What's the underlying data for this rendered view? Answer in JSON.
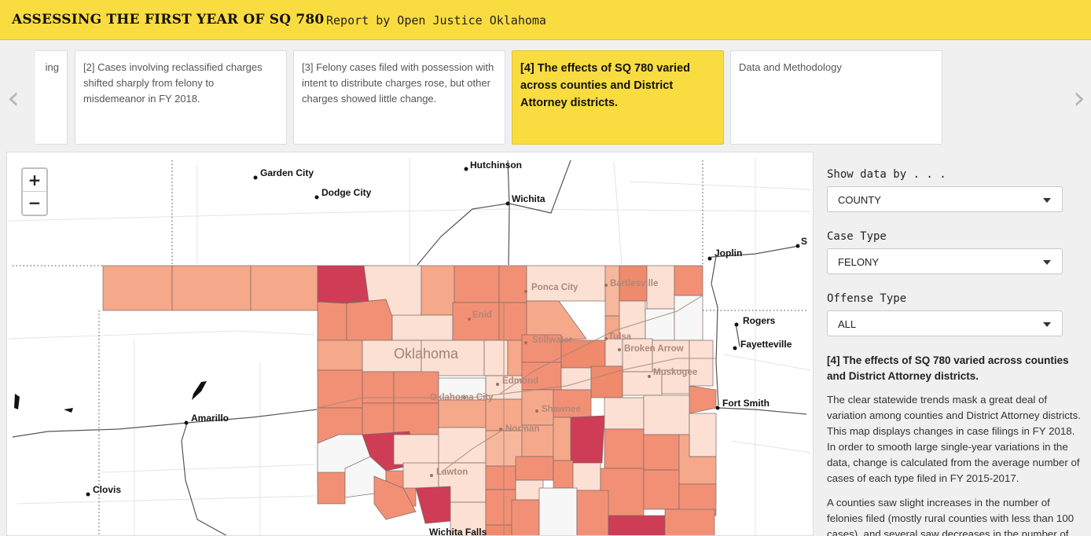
{
  "header": {
    "title": "ASSESSING THE FIRST YEAR OF SQ 780",
    "byline": "Report by Open Justice Oklahoma"
  },
  "nav": {
    "prev_icon": "chevron-left-icon",
    "next_icon": "chevron-right-icon"
  },
  "cards": [
    {
      "text": "ing",
      "active": false
    },
    {
      "text": "[2] Cases involving reclassified charges shifted sharply from felony to misdemeanor in FY 2018.",
      "active": false
    },
    {
      "text": "[3] Felony cases filed with possession with intent to distribute charges rose, but other charges showed little change.",
      "active": false
    },
    {
      "text": "[4] The effects of SQ 780 varied across counties and District Attorney districts.",
      "active": true
    },
    {
      "text": "Data and Methodology",
      "active": false
    }
  ],
  "map": {
    "zoom_in": "+",
    "zoom_out": "−",
    "state_label": "Oklahoma",
    "cities": [
      "Garden City",
      "Dodge City",
      "Hutchinson",
      "Wichita",
      "Joplin",
      "S",
      "Rogers",
      "Fayetteville",
      "Fort Smith",
      "Amarillo",
      "Clovis",
      "Wichita Falls"
    ],
    "faint_cities": [
      "Ponca City",
      "Bartlesville",
      "Enid",
      "Stillwater",
      "Tulsa",
      "Broken Arrow",
      "Muskogee",
      "Edmond",
      "Oklahoma City",
      "Shawnee",
      "Norman",
      "Lawton"
    ],
    "colors": {
      "dark": "#cf3c55",
      "mid": "#ef9478",
      "light": "#f6b79c",
      "pale": "#fbe0d3",
      "white": "#f7f7f7"
    }
  },
  "controls": {
    "show_label": "Show data by . . .",
    "show_value": "COUNTY",
    "case_label": "Case Type",
    "case_value": "FELONY",
    "offense_label": "Offense Type",
    "offense_value": "ALL"
  },
  "panel": {
    "heading": "[4] The effects of SQ 780 varied across counties and District Attorney districts.",
    "p1": "The clear statewide trends mask a great deal of variation among counties and District Attorney districts. This map displays changes in case filings in FY 2018. In order to smooth large single-year variations in the data, change is calculated from the average number of cases of each type filed in FY 2015-2017.",
    "p2": "A counties saw slight increases in the number of felonies filed (mostly rural counties with less than 100 cases), and several saw decreases in the number of"
  }
}
